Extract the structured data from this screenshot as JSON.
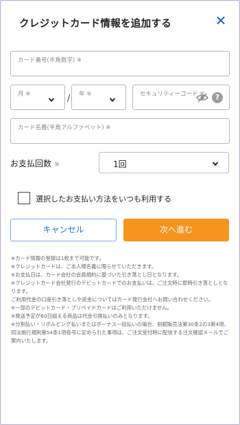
{
  "header": {
    "title": "クレジットカード情報を追加する",
    "close_icon": "close-icon"
  },
  "card_number": {
    "label": "カード番号(半角数字) ※"
  },
  "expiry": {
    "month_label": "月 ※",
    "year_label": "年 ※",
    "separator": "/"
  },
  "security_code": {
    "label": "セキュリティーコード ※",
    "help": "?"
  },
  "card_name": {
    "label": "カード名義(半角アルファベット) ※"
  },
  "payment": {
    "label": "お支払回数",
    "required": "※",
    "selected": "1回"
  },
  "remember": {
    "label": "選択したお支払い方法をいつも利用する",
    "checked": false
  },
  "buttons": {
    "cancel": "キャンセル",
    "next": "次へ進む"
  },
  "colors": {
    "accent": "#1565c0",
    "primary_button": "#f7941d",
    "frame": "#b9a3d6"
  },
  "notes": [
    "※カード情報の登録は1枚まで可能です。",
    "※クレジットカードは、ご本人様名義に限らせていただきます。",
    "※お支払日は、カード会社の会員規約に基づいた引き落とし日となります。",
    "※クレジットカード会社発行のデビットカードでのお支払いは、ご注文時に即時引き落としとなります。",
    "ご利用代金の口座引き落としや返金についてはカード発行会社へお問い合わせください。",
    "※一部のデビットカード・プリペイドカードはご利用いただけません。",
    "※発送予定が60日超える商品は代金引換払いのみとなります。",
    "※分割払い・リボルビング払いまたはボーナス一括払いの場合、割賦販売法第30条2の3第4項、同法施行規則第54条1項各号に定められた事項は、ご注文受付時に配信する注文確認メールでご案内いたします。"
  ]
}
